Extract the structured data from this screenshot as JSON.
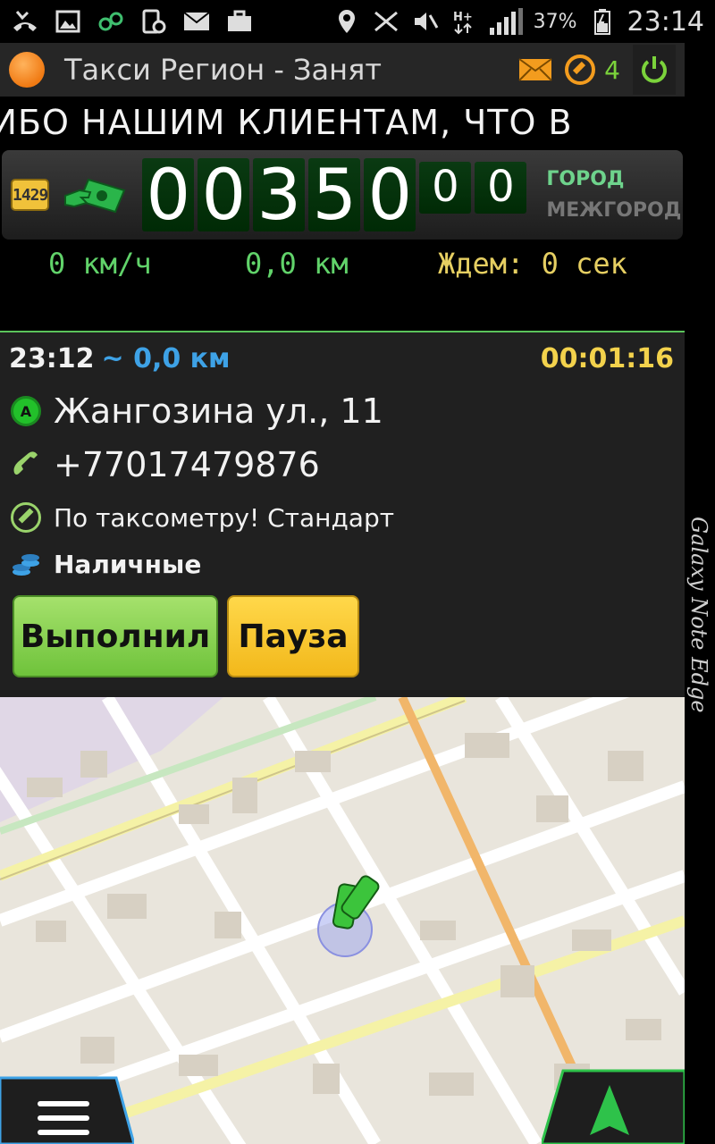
{
  "status_bar": {
    "battery": "37%",
    "time": "23:14",
    "icons": [
      "missed-call-icon",
      "gallery-icon",
      "app-icon",
      "screenshot-icon",
      "email-icon",
      "briefcase-icon",
      "location-icon",
      "nfc-icon",
      "mute-icon",
      "hplus-icon",
      "signal-icon",
      "battery-icon"
    ]
  },
  "title_bar": {
    "title": "Такси Регион - Занят",
    "status_color": "#f07a13",
    "count": "4"
  },
  "marquee": {
    "text": "АСИБО НАШИМ КЛИЕНТАМ, ЧТО В"
  },
  "meter": {
    "tariff_badge": "1429",
    "digits": [
      "0",
      "0",
      "3",
      "5",
      "0"
    ],
    "cents": [
      "0",
      "0"
    ],
    "zone_city": "ГОРОД",
    "zone_intercity": "МЕЖГОРОД"
  },
  "stats": {
    "speed": "0 км/ч",
    "distance": "0,0 км",
    "waiting": "Ждем: 0 сек"
  },
  "order": {
    "time": "23:12",
    "distance": "~ 0,0 км",
    "elapsed": "00:01:16",
    "pin_letter": "A",
    "address": "Жангозина ул., 11",
    "phone": "+77017479876",
    "tariff": "По таксометру! Стандарт",
    "payment": "Наличные",
    "done_button": "Выполнил",
    "pause_button": "Пауза"
  },
  "side_brand": "Galaxy Note Edge",
  "colors": {
    "accent_green": "#61d36a",
    "accent_yellow": "#f3d24c",
    "accent_blue": "#3ea2e6"
  }
}
